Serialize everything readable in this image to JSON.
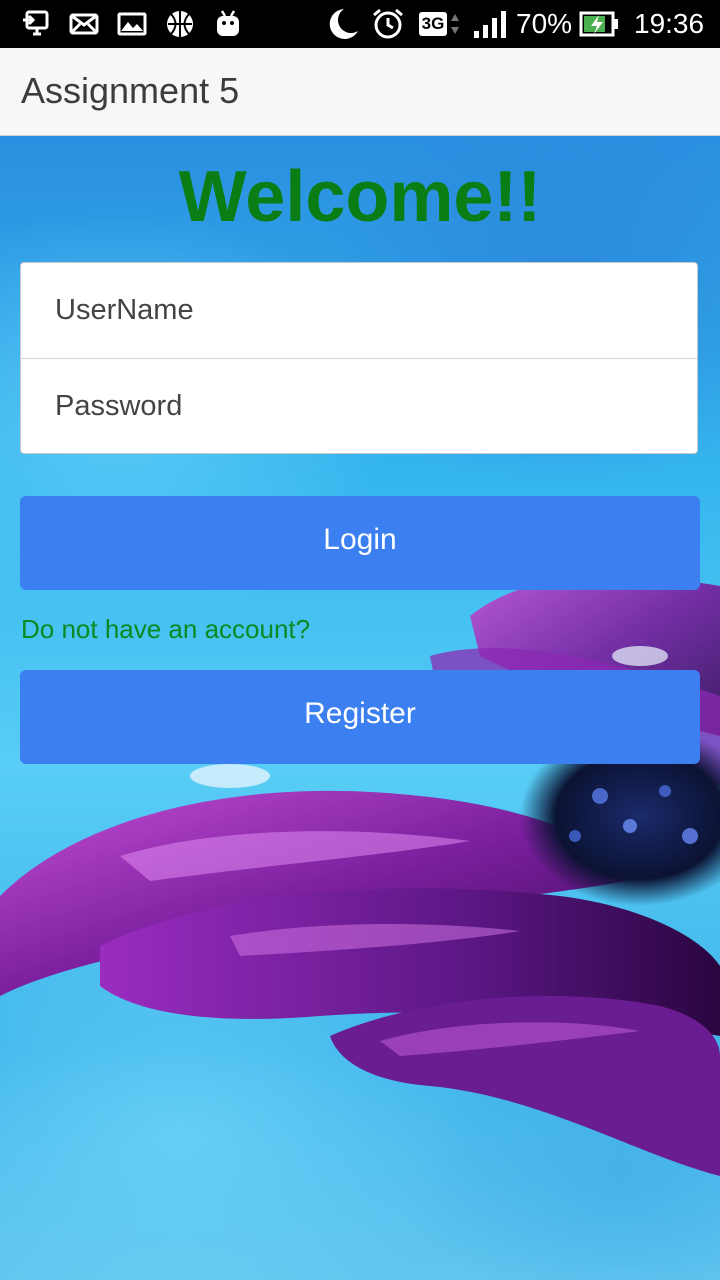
{
  "status_bar": {
    "battery": "70%",
    "time": "19:36",
    "network": "3G",
    "icons": [
      "screen-cast-icon",
      "mail-icon",
      "image-icon",
      "basketball-icon",
      "android-icon",
      "moon-icon",
      "alarm-icon",
      "network-3g-icon",
      "signal-icon",
      "battery-charging-icon"
    ]
  },
  "app_bar": {
    "title": "Assignment 5"
  },
  "main": {
    "welcome": "Welcome!!",
    "username_placeholder": "UserName",
    "password_placeholder": "Password",
    "login_label": "Login",
    "account_prompt": "Do not have an account?",
    "register_label": "Register"
  },
  "colors": {
    "button": "#3b7ff0",
    "welcome_text": "#0a7d14",
    "prompt_text": "#0a8a22",
    "app_bar": "#f7f7f7",
    "status_bar": "#000000"
  }
}
